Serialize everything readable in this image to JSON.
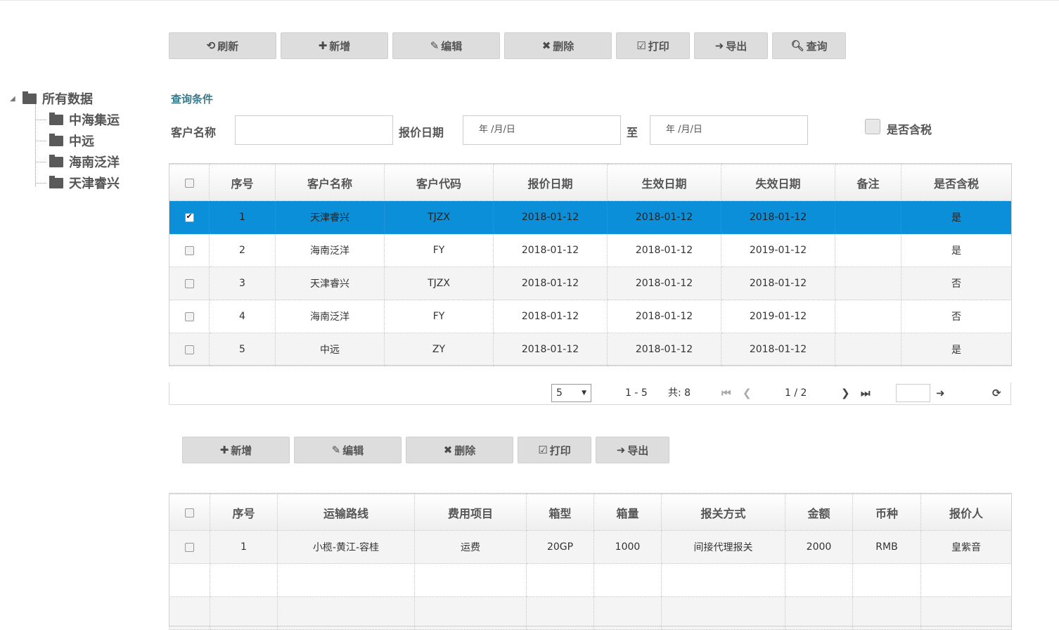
{
  "toolbar_top": {
    "refresh": "刷新",
    "add": "新增",
    "edit": "编辑",
    "delete": "删除",
    "print": "打印",
    "export": "导出",
    "search": "查询"
  },
  "tree": {
    "root": "所有数据",
    "children": [
      "中海集运",
      "中远",
      "海南泛洋",
      "天津睿兴"
    ]
  },
  "query": {
    "title": "查询条件",
    "customer_name_label": "客户名称",
    "customer_name_value": "",
    "quote_date_label": "报价日期",
    "date_from_placeholder": "年 /月/日",
    "to_label": "至",
    "date_to_placeholder": "年 /月/日",
    "tax_label": "是否含税"
  },
  "quote_table": {
    "headers": [
      "序号",
      "客户名称",
      "客户代码",
      "报价日期",
      "生效日期",
      "失效日期",
      "备注",
      "是否含税"
    ],
    "rows": [
      {
        "no": "1",
        "name": "天津睿兴",
        "code": "TJZX",
        "quote": "2018-01-12",
        "effective": "2018-01-12",
        "expire": "2018-01-12",
        "remark": "",
        "tax": "是",
        "checked": true
      },
      {
        "no": "2",
        "name": "海南泛洋",
        "code": "FY",
        "quote": "2018-01-12",
        "effective": "2018-01-12",
        "expire": "2019-01-12",
        "remark": "",
        "tax": "是",
        "checked": false
      },
      {
        "no": "3",
        "name": "天津睿兴",
        "code": "TJZX",
        "quote": "2018-01-12",
        "effective": "2018-01-12",
        "expire": "2018-01-12",
        "remark": "",
        "tax": "否",
        "checked": false
      },
      {
        "no": "4",
        "name": "海南泛洋",
        "code": "FY",
        "quote": "2018-01-12",
        "effective": "2018-01-12",
        "expire": "2019-01-12",
        "remark": "",
        "tax": "否",
        "checked": false
      },
      {
        "no": "5",
        "name": "中远",
        "code": "ZY",
        "quote": "2018-01-12",
        "effective": "2018-01-12",
        "expire": "2018-01-12",
        "remark": "",
        "tax": "是",
        "checked": false
      }
    ]
  },
  "pager": {
    "page_size": "5",
    "range": "1 - 5",
    "total": "共: 8",
    "page": "1 / 2",
    "goto_value": ""
  },
  "toolbar_bottom": {
    "add": "新增",
    "edit": "编辑",
    "delete": "删除",
    "print": "打印",
    "export": "导出"
  },
  "detail_table": {
    "headers": [
      "序号",
      "运输路线",
      "费用项目",
      "箱型",
      "箱量",
      "报关方式",
      "金额",
      "币种",
      "报价人"
    ],
    "rows": [
      {
        "no": "1",
        "route": "小榄-黄江-容桂",
        "item": "运费",
        "box_type": "20GP",
        "box_qty": "1000",
        "customs": "间接代理报关",
        "amount": "2000",
        "currency": "RMB",
        "quoter": "皇紫音"
      }
    ]
  },
  "colors": {
    "selected_row": "#0a8fd8",
    "button_bg": "#dddddd",
    "section_title": "#3a7a8a"
  }
}
